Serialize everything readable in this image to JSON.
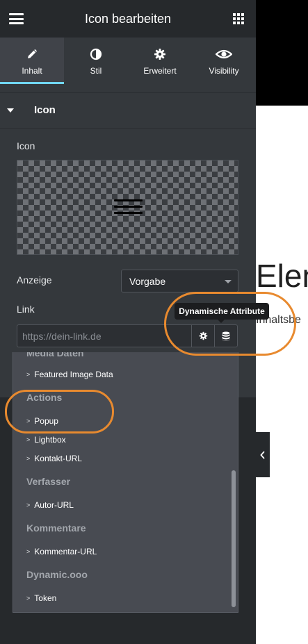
{
  "header": {
    "title": "Icon bearbeiten"
  },
  "tabs": [
    {
      "label": "Inhalt",
      "icon": "pencil-icon",
      "active": true
    },
    {
      "label": "Stil",
      "icon": "contrast-icon",
      "active": false
    },
    {
      "label": "Erweitert",
      "icon": "gear-icon",
      "active": false
    },
    {
      "label": "Visibility",
      "icon": "eye-icon",
      "active": false
    }
  ],
  "section": {
    "title": "Icon"
  },
  "icon_field": {
    "label": "Icon",
    "value_icon": "hamburger-icon"
  },
  "display_field": {
    "label": "Anzeige",
    "value": "Vorgabe"
  },
  "link_field": {
    "label": "Link",
    "placeholder": "https://dein-link.de"
  },
  "tooltip": {
    "text": "Dynamische Attribute"
  },
  "dropdown": {
    "cut_group": "Media Daten",
    "items": [
      {
        "type": "item",
        "label": "Featured Image Data"
      },
      {
        "type": "group",
        "label": "Actions"
      },
      {
        "type": "item",
        "label": "Popup"
      },
      {
        "type": "item",
        "label": "Lightbox"
      },
      {
        "type": "item",
        "label": "Kontakt-URL"
      },
      {
        "type": "group",
        "label": "Verfasser"
      },
      {
        "type": "item",
        "label": "Autor-URL"
      },
      {
        "type": "group",
        "label": "Kommentare"
      },
      {
        "type": "item",
        "label": "Kommentar-URL"
      },
      {
        "type": "group",
        "label": "Dynamic.ooo"
      },
      {
        "type": "item",
        "label": "Token"
      }
    ],
    "item_prefix": ">"
  },
  "preview": {
    "heading": "Elen",
    "subtext": "Inhaltsbe"
  },
  "colors": {
    "accent": "#71d7f7",
    "highlight": "#e88a2f",
    "panel": "#34383c",
    "header": "#26292c"
  }
}
